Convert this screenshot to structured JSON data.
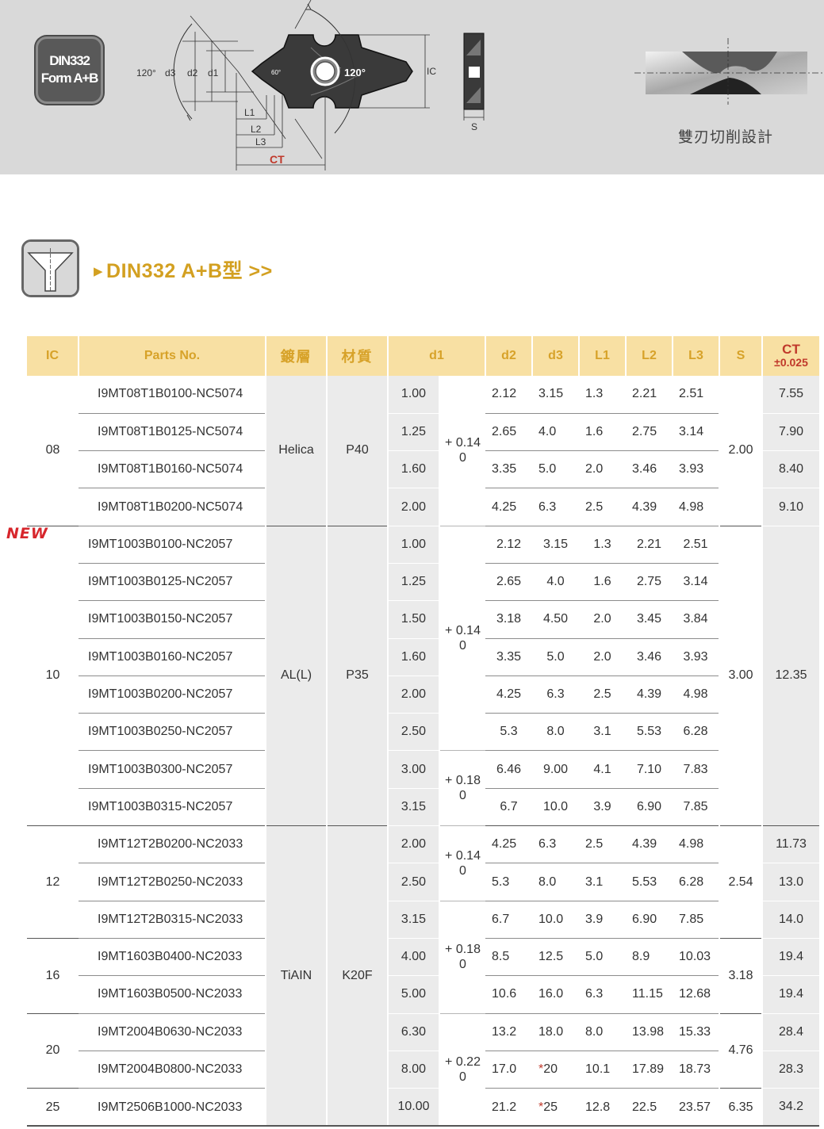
{
  "banner": {
    "badge_line1": "DIN332",
    "badge_line2": "Form A+B",
    "drawing_labels": {
      "angle_outer": "120°",
      "d3": "d3",
      "d2": "d2",
      "d1": "d1",
      "angle_tip": "60°",
      "angle_insert": "120°",
      "ic": "IC",
      "l1": "L1",
      "l2": "L2",
      "l3": "L3",
      "ct": "CT",
      "s": "S"
    },
    "caption": "雙刃切削設計"
  },
  "section": {
    "title": "DIN332 A+B型 >>"
  },
  "new_tag": "NEW",
  "table": {
    "headers": {
      "ic": "IC",
      "part": "Parts No.",
      "coating": "鍍層",
      "material": "材質",
      "d1": "d1",
      "d2": "d2",
      "d3": "d3",
      "l1": "L1",
      "l2": "L2",
      "l3": "L3",
      "s": "S",
      "ct": "CT",
      "ct_tol": "±0.025"
    },
    "groups": {
      "g08": {
        "ic": "08",
        "coating": "Helica",
        "material": "P40",
        "s": "2.00"
      },
      "g10": {
        "ic": "10",
        "coating": "AL(L)",
        "material": "P35",
        "s": "3.00",
        "ct": "12.35"
      },
      "g12": {
        "ic": "12",
        "s": "2.54"
      },
      "g16": {
        "ic": "16",
        "coating": "TiAIN",
        "material": "K20F",
        "s": "3.18"
      },
      "g20": {
        "ic": "20",
        "s": "4.76"
      },
      "g25": {
        "ic": "25",
        "s": "6.35"
      }
    },
    "tolerances": {
      "t014_a": "+ 0.14\n0",
      "t014_b": "+ 0.14\n0",
      "t018_a": "+ 0.18\n0",
      "t014_c": "+ 0.14\n0",
      "t018_b": "+ 0.18\n0",
      "t022": "+ 0.22\n0"
    },
    "rows": [
      {
        "part": "I9MT08T1B0100-NC5074",
        "d1": "1.00",
        "d2": "2.12",
        "d3": "3.15",
        "l1": "1.3",
        "l2": "2.21",
        "l3": "2.51",
        "ct": "7.55"
      },
      {
        "part": "I9MT08T1B0125-NC5074",
        "d1": "1.25",
        "d2": "2.65",
        "d3": "4.0",
        "l1": "1.6",
        "l2": "2.75",
        "l3": "3.14",
        "ct": "7.90"
      },
      {
        "part": "I9MT08T1B0160-NC5074",
        "d1": "1.60",
        "d2": "3.35",
        "d3": "5.0",
        "l1": "2.0",
        "l2": "3.46",
        "l3": "3.93",
        "ct": "8.40"
      },
      {
        "part": "I9MT08T1B0200-NC5074",
        "d1": "2.00",
        "d2": "4.25",
        "d3": "6.3",
        "l1": "2.5",
        "l2": "4.39",
        "l3": "4.98",
        "ct": "9.10"
      },
      {
        "part": "I9MT1003B0100-NC2057",
        "d1": "1.00",
        "d2": "2.12",
        "d3": "3.15",
        "l1": "1.3",
        "l2": "2.21",
        "l3": "2.51"
      },
      {
        "part": "I9MT1003B0125-NC2057",
        "d1": "1.25",
        "d2": "2.65",
        "d3": "4.0",
        "l1": "1.6",
        "l2": "2.75",
        "l3": "3.14"
      },
      {
        "part": "I9MT1003B0150-NC2057",
        "d1": "1.50",
        "d2": "3.18",
        "d3": "4.50",
        "l1": "2.0",
        "l2": "3.45",
        "l3": "3.84"
      },
      {
        "part": "I9MT1003B0160-NC2057",
        "d1": "1.60",
        "d2": "3.35",
        "d3": "5.0",
        "l1": "2.0",
        "l2": "3.46",
        "l3": "3.93"
      },
      {
        "part": "I9MT1003B0200-NC2057",
        "d1": "2.00",
        "d2": "4.25",
        "d3": "6.3",
        "l1": "2.5",
        "l2": "4.39",
        "l3": "4.98"
      },
      {
        "part": "I9MT1003B0250-NC2057",
        "d1": "2.50",
        "d2": "5.3",
        "d3": "8.0",
        "l1": "3.1",
        "l2": "5.53",
        "l3": "6.28"
      },
      {
        "part": "I9MT1003B0300-NC2057",
        "d1": "3.00",
        "d2": "6.46",
        "d3": "9.00",
        "l1": "4.1",
        "l2": "7.10",
        "l3": "7.83"
      },
      {
        "part": "I9MT1003B0315-NC2057",
        "d1": "3.15",
        "d2": "6.7",
        "d3": "10.0",
        "l1": "3.9",
        "l2": "6.90",
        "l3": "7.85"
      },
      {
        "part": "I9MT12T2B0200-NC2033",
        "d1": "2.00",
        "d2": "4.25",
        "d3": "6.3",
        "l1": "2.5",
        "l2": "4.39",
        "l3": "4.98",
        "ct": "11.73"
      },
      {
        "part": "I9MT12T2B0250-NC2033",
        "d1": "2.50",
        "d2": "5.3",
        "d3": "8.0",
        "l1": "3.1",
        "l2": "5.53",
        "l3": "6.28",
        "ct": "13.0"
      },
      {
        "part": "I9MT12T2B0315-NC2033",
        "d1": "3.15",
        "d2": "6.7",
        "d3": "10.0",
        "l1": "3.9",
        "l2": "6.90",
        "l3": "7.85",
        "ct": "14.0"
      },
      {
        "part": "I9MT1603B0400-NC2033",
        "d1": "4.00",
        "d2": "8.5",
        "d3": "12.5",
        "l1": "5.0",
        "l2": "8.9",
        "l3": "10.03",
        "ct": "19.4"
      },
      {
        "part": "I9MT1603B0500-NC2033",
        "d1": "5.00",
        "d2": "10.6",
        "d3": "16.0",
        "l1": "6.3",
        "l2": "11.15",
        "l3": "12.68",
        "ct": "19.4"
      },
      {
        "part": "I9MT2004B0630-NC2033",
        "d1": "6.30",
        "d2": "13.2",
        "d3": "18.0",
        "l1": "8.0",
        "l2": "13.98",
        "l3": "15.33",
        "ct": "28.4"
      },
      {
        "part": "I9MT2004B0800-NC2033",
        "d1": "8.00",
        "d2": "17.0",
        "d3_star": "*",
        "d3": "20",
        "l1": "10.1",
        "l2": "17.89",
        "l3": "18.73",
        "ct": "28.3"
      },
      {
        "part": "I9MT2506B1000-NC2033",
        "d1": "10.00",
        "d2": "21.2",
        "d3_star": "*",
        "d3": "25",
        "l1": "12.8",
        "l2": "22.5",
        "l3": "23.57",
        "ct": "34.2"
      }
    ]
  }
}
